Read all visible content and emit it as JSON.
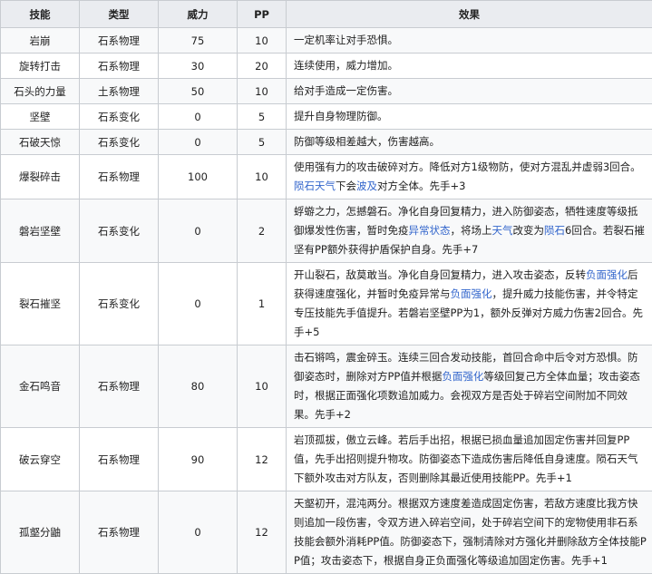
{
  "headers": [
    "技能",
    "类型",
    "威力",
    "PP",
    "效果"
  ],
  "rows": [
    {
      "name": "岩崩",
      "type": "石系物理",
      "power": "75",
      "pp": "10",
      "effect": [
        {
          "t": "一定机率让对手恐惧。"
        }
      ]
    },
    {
      "name": "旋转打击",
      "type": "石系物理",
      "power": "30",
      "pp": "20",
      "effect": [
        {
          "t": "连续使用，威力增加。"
        }
      ]
    },
    {
      "name": "石头的力量",
      "type": "土系物理",
      "power": "50",
      "pp": "10",
      "effect": [
        {
          "t": "给对手造成一定伤害。"
        }
      ]
    },
    {
      "name": "坚壁",
      "type": "石系变化",
      "power": "0",
      "pp": "5",
      "effect": [
        {
          "t": "提升自身物理防御。"
        }
      ]
    },
    {
      "name": "石破天惊",
      "type": "石系变化",
      "power": "0",
      "pp": "5",
      "effect": [
        {
          "t": "防御等级相差越大，伤害越高。"
        }
      ]
    },
    {
      "name": "爆裂碎击",
      "type": "石系物理",
      "power": "100",
      "pp": "10",
      "effect": [
        {
          "t": "使用强有力的攻击破碎对方。降低对方1级物防，使对方混乱并虚弱3回合。"
        },
        {
          "t": "陨石天气",
          "link": true
        },
        {
          "t": "下会"
        },
        {
          "t": "波及",
          "link": true
        },
        {
          "t": "对方全体。先手+3"
        }
      ]
    },
    {
      "name": "磐岩坚壁",
      "type": "石系变化",
      "power": "0",
      "pp": "2",
      "effect": [
        {
          "t": "蜉蝣之力，怎撼磐石。净化自身回复精力，进入防御姿态，牺牲速度等级抵御爆发性伤害，暂时免疫"
        },
        {
          "t": "异常状态",
          "link": true
        },
        {
          "t": "，将场上"
        },
        {
          "t": "天气",
          "link": true
        },
        {
          "t": "改变为"
        },
        {
          "t": "陨石",
          "link": true
        },
        {
          "t": "6回合。若裂石摧坚有PP额外获得护盾保护自身。先手+7"
        }
      ]
    },
    {
      "name": "裂石摧坚",
      "type": "石系变化",
      "power": "0",
      "pp": "1",
      "effect": [
        {
          "t": "开山裂石，敌莫敢当。净化自身回复精力，进入攻击姿态，反转"
        },
        {
          "t": "负面强化",
          "link": true
        },
        {
          "t": "后获得速度强化，并暂时免疫异常与"
        },
        {
          "t": "负面强化",
          "link": true
        },
        {
          "t": "，提升威力技能伤害，并令特定专压技能先手值提升。若磐岩坚壁PP为1，额外反弹对方威力伤害2回合。先手+5"
        }
      ]
    },
    {
      "name": "金石鸣音",
      "type": "石系物理",
      "power": "80",
      "pp": "10",
      "effect": [
        {
          "t": "击石锵鸣，震金碎玉。连续三回合发动技能，首回合命中后令对方恐惧。防御姿态时，删除对方PP值并根据"
        },
        {
          "t": "负面强化",
          "link": true
        },
        {
          "t": "等级回复己方全体血量；攻击姿态时，根据正面强化项数追加威力。会视双方是否处于碎岩空间附加不同效果。先手+2"
        }
      ]
    },
    {
      "name": "破云穿空",
      "type": "石系物理",
      "power": "90",
      "pp": "12",
      "effect": [
        {
          "t": "岩顶孤拔，傲立云峰。若后手出招，根据已损血量追加固定伤害并回复PP值，先手出招则提升物攻。防御姿态下造成伤害后降低自身速度。陨石天气下额外攻击对方队友，否则删除其最近使用技能PP。先手+1"
        }
      ]
    },
    {
      "name": "孤壑分鼬",
      "type": "石系物理",
      "power": "0",
      "pp": "12",
      "effect": [
        {
          "t": "天壑初开，混沌两分。根据双方速度差造成固定伤害，若敌方速度比我方快则追加一段伤害，令双方进入碎岩空间，处于碎岩空间下的宠物使用非石系技能会额外消耗PP值。防御姿态下，强制清除对方强化并删除敌方全体技能PP值；攻击姿态下，根据自身正负面强化等级追加固定伤害。先手+1"
        }
      ]
    }
  ]
}
